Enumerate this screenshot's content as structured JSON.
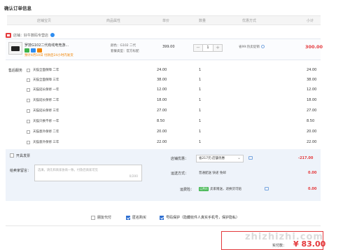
{
  "page_title": "确认订单信息",
  "columns": [
    "店铺宝贝",
    "商品属性",
    "单价",
    "数量",
    "优惠方式",
    "小计"
  ],
  "shop": {
    "label": "店铺：好牛数码专营店"
  },
  "item": {
    "name": "罗技G102二代有线电竞游...",
    "delivery_note": "预计4月10日 付款后24小时内发货",
    "attr_color": "颜色：G102 二代",
    "attr_kit": "套餐类型：官方标配",
    "price": "399.00",
    "qty": "1",
    "promo": "省99:热卖促销",
    "subtotal": "300.00",
    "colors": {
      "accent": "#e4393c",
      "badge_a": "#3bb34a",
      "badge_b": "#2e8df0",
      "badge_c": "#f08300"
    }
  },
  "services": {
    "label": "售后服务",
    "rows": [
      {
        "name": "天猫全面保障 二年",
        "price": "24.00",
        "qty": "1",
        "subtotal": "24.00"
      },
      {
        "name": "天猫全面保障 三年",
        "price": "38.00",
        "qty": "1",
        "subtotal": "38.00"
      },
      {
        "name": "天猫延长保修 一年",
        "price": "12.00",
        "qty": "1",
        "subtotal": "12.00"
      },
      {
        "name": "天猫延长保修 二年",
        "price": "18.00",
        "qty": "1",
        "subtotal": "18.00"
      },
      {
        "name": "天猫延长保修 三年",
        "price": "27.00",
        "qty": "1",
        "subtotal": "27.00"
      },
      {
        "name": "天猫只换不修 一年",
        "price": "8.50",
        "qty": "1",
        "subtotal": "8.50"
      },
      {
        "name": "天猫意外保修 二年",
        "price": "20.00",
        "qty": "1",
        "subtotal": "20.00"
      },
      {
        "name": "天猫意外保修 三年",
        "price": "22.00",
        "qty": "1",
        "subtotal": "22.00"
      }
    ]
  },
  "invoice_label": "开具发票",
  "message": {
    "label": "给卖家留言：",
    "placeholder": "选填，请先和商家协商一致，付款后商家可见",
    "count": "0/200"
  },
  "coupon": {
    "label": "店铺优惠：",
    "selected": "省217元:店舗优惠 ",
    "amount": "-217.00"
  },
  "shipping": {
    "label": "运送方式：",
    "value": "普通配送 快递 免邮",
    "amount": "0.00"
  },
  "freight_insurance": {
    "label": "运费险：",
    "tag": "运费险",
    "value": "卖家赠送，退换货可赔",
    "amount": "0.00"
  },
  "bottom_options": {
    "friend_pay": "朋友代付",
    "anonymous": "匿名购买",
    "privacy": "号码保护（隐藏收件人真实手机号，保护隐私）"
  },
  "total": {
    "label": "实付款：",
    "amount": "¥ 83.00"
  },
  "watermark": "zhizhizhi.com"
}
